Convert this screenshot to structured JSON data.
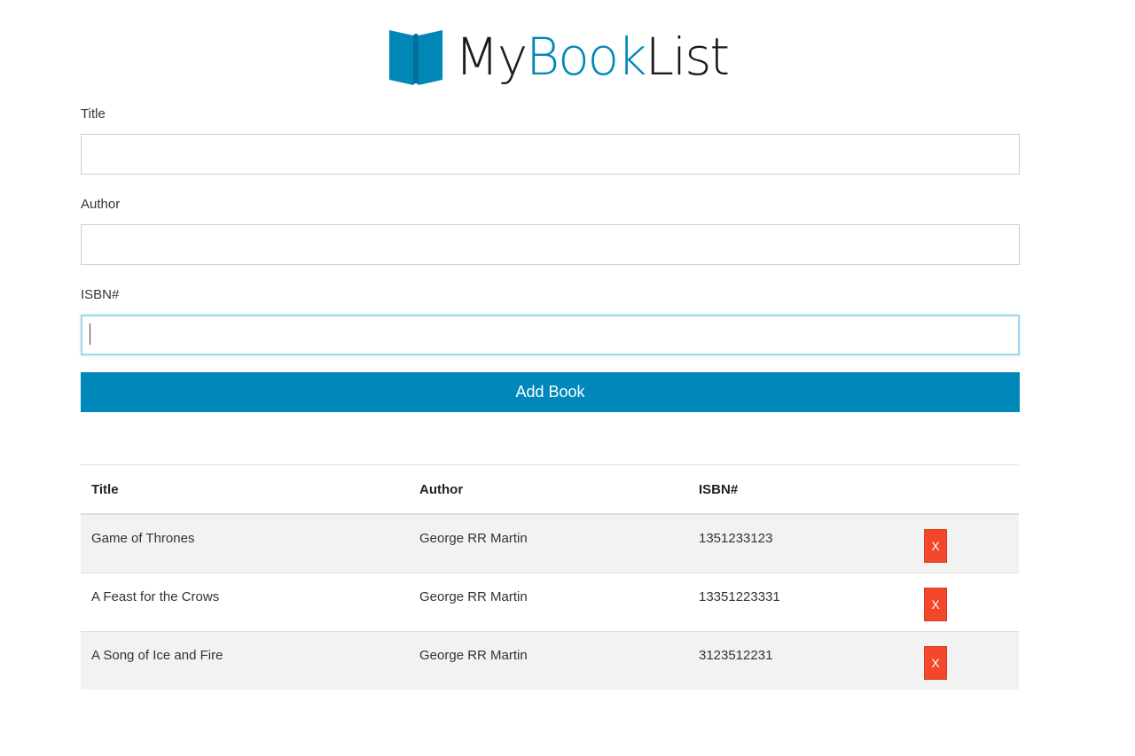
{
  "brand": {
    "name_part1": "My",
    "name_part2": "Book",
    "name_part3": "List",
    "accent_color": "#0087b8",
    "icon": "open-book-icon"
  },
  "form": {
    "title_label": "Title",
    "title_value": "",
    "author_label": "Author",
    "author_value": "",
    "isbn_label": "ISBN#",
    "isbn_value": "",
    "submit_label": "Add Book",
    "submit_color": "#0088ba"
  },
  "table": {
    "headers": [
      "Title",
      "Author",
      "ISBN#"
    ],
    "delete_label": "X",
    "delete_color": "#f2472a",
    "rows": [
      {
        "title": "Game of Thrones",
        "author": "George RR Martin",
        "isbn": "1351233123"
      },
      {
        "title": "A Feast for the Crows",
        "author": "George RR Martin",
        "isbn": "13351223331"
      },
      {
        "title": "A Song of Ice and Fire",
        "author": "George RR Martin",
        "isbn": "3123512231"
      }
    ]
  }
}
